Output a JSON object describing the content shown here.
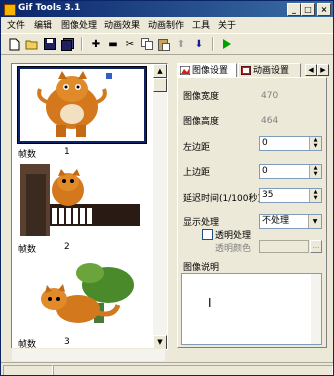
{
  "window": {
    "title": "Gif Tools 3.1"
  },
  "menu": [
    "文件",
    "编辑",
    "图像处理",
    "动画效果",
    "动画制作",
    "工具",
    "关于"
  ],
  "toolbar": {
    "buttons": [
      "new-icon",
      "open-icon",
      "save-icon",
      "save-all-icon",
      "add-icon",
      "remove-icon",
      "cut-icon",
      "copy-icon",
      "paste-icon",
      "move-up-icon",
      "move-down-icon",
      "play-icon"
    ]
  },
  "frames": [
    {
      "label": "帧数",
      "number": "1"
    },
    {
      "label": "帧数",
      "number": "2"
    },
    {
      "label": "帧数",
      "number": "3"
    }
  ],
  "tabs": [
    "图像设置",
    "动画设置"
  ],
  "settings": {
    "width_label": "图像宽度",
    "width_value": "470",
    "height_label": "图像高度",
    "height_value": "464",
    "left_margin_label": "左边距",
    "left_margin_value": "0",
    "top_margin_label": "上边距",
    "top_margin_value": "0",
    "delay_label": "延迟时间(1/100秒)",
    "delay_value": "35",
    "display_label": "显示处理",
    "display_value": "不处理",
    "transparent_label": "透明处理",
    "transparent_color_label": "透明颜色",
    "transparent_color_btn": "...",
    "description_label": "图像说明",
    "cursor": "I"
  },
  "colors": {
    "title_bar": "#0a246a",
    "face": "#ece9d8",
    "cat_orange": "#d4781e"
  }
}
